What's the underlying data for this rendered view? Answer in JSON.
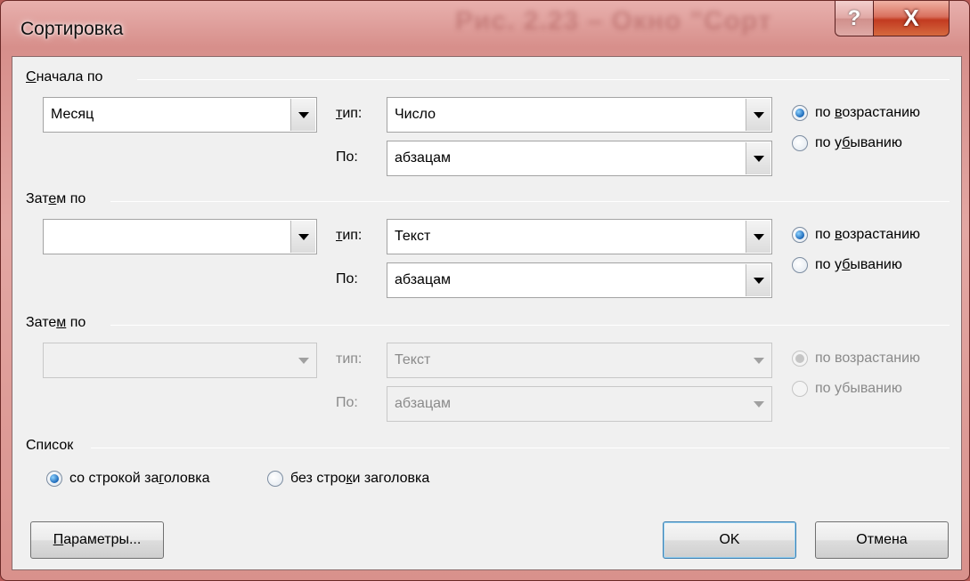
{
  "window": {
    "title": "Сортировка",
    "ghost_title": "Рис. 2.23 – Окно \"Сорт",
    "help_label": "?",
    "close_label": "X"
  },
  "sections": [
    {
      "title": "Сначала по",
      "field": "Месяц",
      "type_label": "тип:",
      "type_value": "Число",
      "by_label": "По:",
      "by_value": "абзацам",
      "asc_label": "по возрастанию",
      "desc_label": "по убыванию",
      "selected": "asc",
      "enabled": true
    },
    {
      "title": "Затем по",
      "field": "",
      "type_label": "тип:",
      "type_value": "Текст",
      "by_label": "По:",
      "by_value": "абзацам",
      "asc_label": "по возрастанию",
      "desc_label": "по убыванию",
      "selected": "asc",
      "enabled": true
    },
    {
      "title": "Затем по",
      "field": "",
      "type_label": "тип:",
      "type_value": "Текст",
      "by_label": "По:",
      "by_value": "абзацам",
      "asc_label": "по возрастанию",
      "desc_label": "по убыванию",
      "selected": "asc",
      "enabled": false
    }
  ],
  "list": {
    "title": "Список",
    "with_header": "со строкой заголовка",
    "without_header": "без строки заголовка",
    "selected": "with_header"
  },
  "buttons": {
    "options": "Параметры...",
    "ok": "OK",
    "cancel": "Отмена"
  }
}
